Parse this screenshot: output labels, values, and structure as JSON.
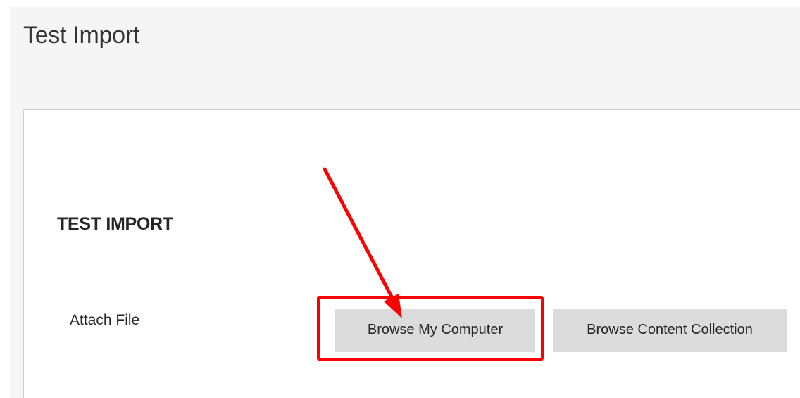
{
  "page": {
    "title": "Test Import"
  },
  "section": {
    "title": "TEST IMPORT"
  },
  "attach_file": {
    "label": "Attach File",
    "browse_computer_label": "Browse My Computer",
    "browse_collection_label": "Browse Content Collection"
  },
  "annotation": {
    "color": "#ff0000",
    "shape": "red-arrow-and-box",
    "target": "browse-my-computer-button"
  },
  "colors": {
    "page_background": "#f5f5f5",
    "panel_background": "#ffffff",
    "button_background": "#dcdcdc",
    "text": "#262626"
  }
}
